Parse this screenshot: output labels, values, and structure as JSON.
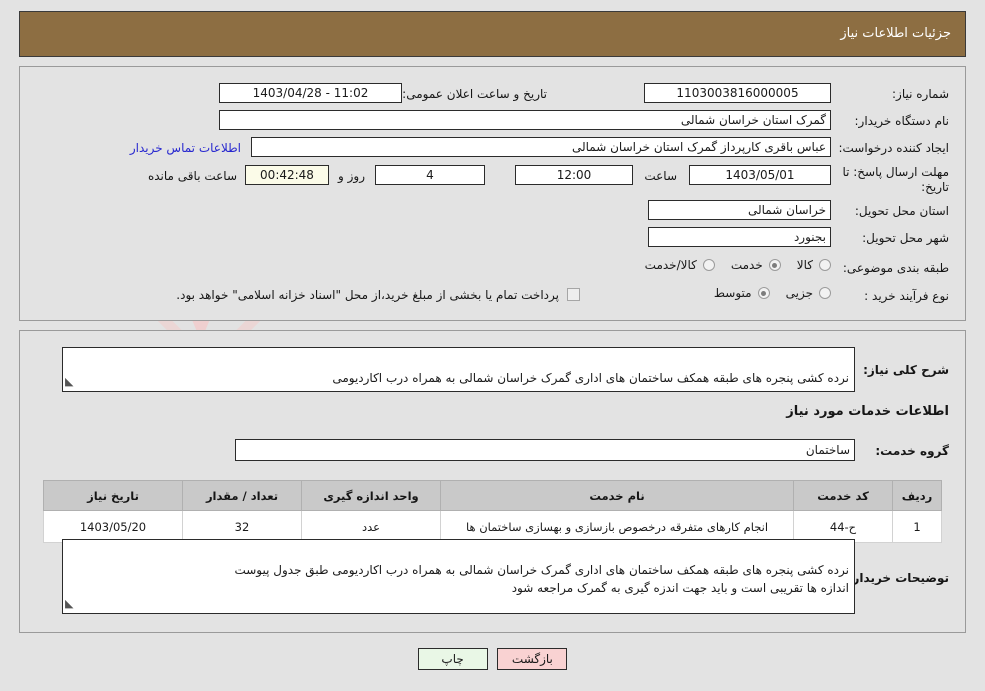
{
  "header": {
    "title": "جزئیات اطلاعات نیاز",
    "bar_color": "#8d6e42"
  },
  "watermark": {
    "text": "AriaTender.net",
    "letter": "V"
  },
  "top_panel": {
    "need_number_label": "شماره نیاز:",
    "need_number_value": "1103003816000005",
    "public_announce_label": "تاریخ و ساعت اعلان عمومی:",
    "public_announce_value": "1403/04/28 - 11:02",
    "buyer_org_label": "نام دستگاه خریدار:",
    "buyer_org_value": "گمرک استان خراسان شمالی",
    "creator_label": "ایجاد کننده درخواست:",
    "creator_value": "عباس باقری کارپرداز گمرک استان خراسان شمالی",
    "contact_link": "اطلاعات تماس خریدار",
    "deadline_label_line1": "مهلت ارسال پاسخ: تا",
    "deadline_label_line2": "تاریخ:",
    "deadline_date": "1403/05/01",
    "deadline_hour_label": "ساعت",
    "deadline_hour_value": "12:00",
    "remaining_days": "4",
    "remaining_days_label": "روز و",
    "remaining_time": "00:42:48",
    "remaining_time_label": "ساعت باقی مانده",
    "province_label": "استان محل تحویل:",
    "province_value": "خراسان شمالی",
    "city_label": "شهر محل تحویل:",
    "city_value": "بجنورد",
    "category_label": "طبقه بندی موضوعی:",
    "category_options": [
      {
        "label": "کالا",
        "selected": false
      },
      {
        "label": "خدمت",
        "selected": true
      },
      {
        "label": "کالا/خدمت",
        "selected": false
      }
    ],
    "process_label": "نوع فرآیند خرید :",
    "process_options": [
      {
        "label": "جزیی",
        "selected": false
      },
      {
        "label": "متوسط",
        "selected": true
      }
    ],
    "treasury_checkbox_text": "پرداخت تمام یا بخشی از مبلغ خرید،از محل \"اسناد خزانه اسلامی\" خواهد بود."
  },
  "bottom_panel": {
    "need_desc_label": "شرح کلی نیاز:",
    "need_desc_value": "نرده کشی پنجره های طبقه همکف ساختمان های اداری گمرک خراسان شمالی به همراه درب اکاردیومی\nطبق جدول پیوست",
    "services_info_heading": "اطلاعات خدمات مورد نیاز",
    "service_group_label": "گروه خدمت:",
    "service_group_value": "ساختمان",
    "table": {
      "columns": [
        "ردیف",
        "کد خدمت",
        "نام خدمت",
        "واحد اندازه گیری",
        "تعداد / مقدار",
        "تاریخ نیاز"
      ],
      "rows": [
        {
          "row_no": "1",
          "service_code": "ح-44",
          "service_name": "انجام کارهای متفرقه درخصوص بازسازی و بهسازی ساختمان ها",
          "unit": "عدد",
          "quantity": "32",
          "need_date": "1403/05/20"
        }
      ]
    },
    "buyer_notes_label": "توضیحات خریدار:",
    "buyer_notes_value": "نرده کشی پنجره های طبقه همکف ساختمان های اداری گمرک خراسان شمالی به همراه درب اکاردیومی  طبق جدول پیوست\nاندازه ها تقریبی است و باید جهت اندزه گیری به گمرک مراجعه شود"
  },
  "footer": {
    "print_label": "چاپ",
    "back_label": "بازگشت"
  }
}
